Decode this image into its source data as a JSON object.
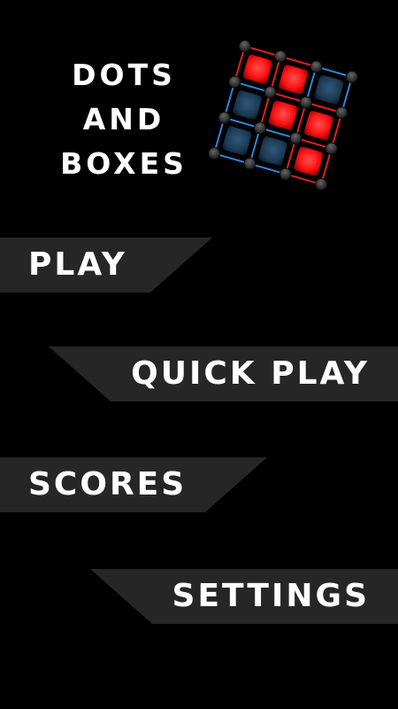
{
  "title": {
    "line1": "DOTS",
    "line2": "AND",
    "line3": "BOXES"
  },
  "logo": {
    "icon": "dots-and-boxes-logo-icon",
    "grid_size": 3,
    "boxes": [
      [
        "red",
        "red",
        "blue"
      ],
      [
        "blue",
        "red",
        "red"
      ],
      [
        "blue",
        "blue",
        "red"
      ]
    ],
    "colors": {
      "red": "#ff1a1a",
      "blue": "#1c3a55",
      "red_line": "#e02020",
      "blue_line": "#2e86d6",
      "dot": "#2a2a2a"
    }
  },
  "menu": {
    "play": "PLAY",
    "quick_play": "QUICK PLAY",
    "scores": "SCORES",
    "settings": "SETTINGS"
  },
  "colors": {
    "background": "#000000",
    "bar": "#262626",
    "text": "#ffffff"
  }
}
